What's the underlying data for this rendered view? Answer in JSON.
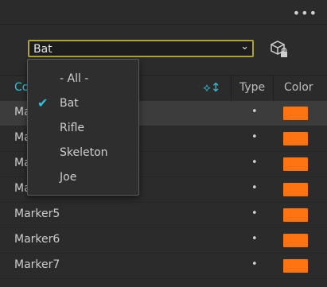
{
  "panel": {
    "filter": {
      "selected": "Bat"
    },
    "columns": {
      "name": "Co",
      "type": "Type",
      "color": "Color"
    },
    "dropdown": {
      "options": [
        "- All -",
        "Bat",
        "Rifle",
        "Skeleton",
        "Joe"
      ],
      "checked_index": 1
    },
    "rows": [
      {
        "name": "Ma",
        "color": "#ff7412"
      },
      {
        "name": "Ma",
        "color": "#ff7412"
      },
      {
        "name": "Ma",
        "color": "#ff7412"
      },
      {
        "name": "Ma",
        "color": "#ff7412"
      },
      {
        "name": "Marker5",
        "color": "#ff7412"
      },
      {
        "name": "Marker6",
        "color": "#ff7412"
      },
      {
        "name": "Marker7",
        "color": "#ff7412"
      }
    ],
    "row_type_glyph": "•",
    "more_glyph": "•••"
  },
  "colors": {
    "accent": "#2cc6e0",
    "swatch": "#ff7412",
    "focus_border": "#b0a23a"
  }
}
